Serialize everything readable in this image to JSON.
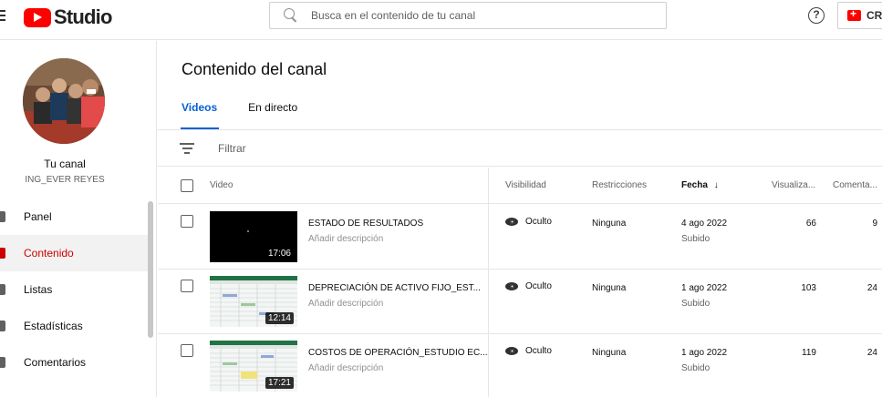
{
  "header": {
    "logo_text": "Studio",
    "search_placeholder": "Busca en el contenido de tu canal",
    "help_label": "?",
    "create_label": "CRE"
  },
  "sidebar": {
    "channel_title": "Tu canal",
    "channel_name": "ING_EVER REYES",
    "items": [
      {
        "label": "Panel",
        "icon": "dashboard-icon",
        "active": false
      },
      {
        "label": "Contenido",
        "icon": "content-icon",
        "active": true
      },
      {
        "label": "Listas",
        "icon": "playlists-icon",
        "active": false
      },
      {
        "label": "Estadísticas",
        "icon": "analytics-icon",
        "active": false
      },
      {
        "label": "Comentarios",
        "icon": "comments-icon",
        "active": false
      }
    ]
  },
  "main": {
    "title": "Contenido del canal",
    "tabs": [
      {
        "label": "Videos",
        "active": true
      },
      {
        "label": "En directo",
        "active": false
      }
    ],
    "filter_label": "Filtrar",
    "columns": {
      "video": "Video",
      "visibility": "Visibilidad",
      "restrictions": "Restricciones",
      "date": "Fecha",
      "views": "Visualiza...",
      "comments": "Comenta..."
    },
    "rows": [
      {
        "title": "ESTADO DE RESULTADOS",
        "description": "Añadir descripción",
        "duration": "17:06",
        "visibility": "Oculto",
        "restrictions": "Ninguna",
        "date": "4 ago 2022",
        "date_status": "Subido",
        "views": "66",
        "comments": "9",
        "thumb": "dark"
      },
      {
        "title": "DEPRECIACIÓN DE ACTIVO FIJO_EST...",
        "description": "Añadir descripción",
        "duration": "12:14",
        "visibility": "Oculto",
        "restrictions": "Ninguna",
        "date": "1 ago 2022",
        "date_status": "Subido",
        "views": "103",
        "comments": "24",
        "thumb": "sheet"
      },
      {
        "title": "COSTOS DE OPERACIÓN_ESTUDIO EC...",
        "description": "Añadir descripción",
        "duration": "17:21",
        "visibility": "Oculto",
        "restrictions": "Ninguna",
        "date": "1 ago 2022",
        "date_status": "Subido",
        "views": "119",
        "comments": "24",
        "thumb": "sheet"
      }
    ]
  },
  "colors": {
    "brand_red": "#ff0000",
    "active_red": "#cc0000",
    "link_blue": "#065fd4"
  }
}
